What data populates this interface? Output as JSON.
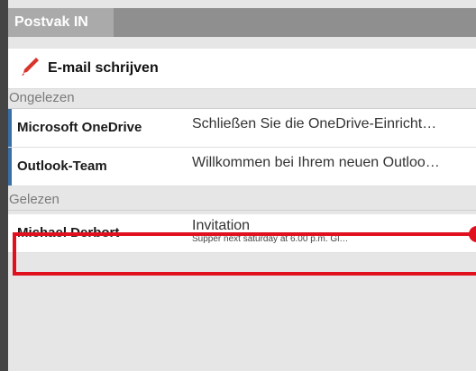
{
  "header": {
    "title": "Postvak IN"
  },
  "compose": {
    "label": "E-mail schrijven",
    "icon": "pen-icon"
  },
  "sections": {
    "unread": {
      "label": "Ongelezen"
    },
    "read": {
      "label": "Gelezen"
    }
  },
  "messages": {
    "unread": [
      {
        "sender": "Microsoft OneDrive",
        "subject": "Schließen Sie die OneDrive-Einricht…"
      },
      {
        "sender": "Outlook-Team",
        "subject": "Willkommen bei Ihrem neuen Outloo…"
      }
    ],
    "read": [
      {
        "sender": "Michael Derbort",
        "subject": "Invitation",
        "preview": "Supper next saturday at 6.00 p.m. Gl…"
      }
    ]
  },
  "colors": {
    "unread_marker": "#3a6fa6",
    "highlight": "#e0101e",
    "pen": "#d9342b"
  }
}
